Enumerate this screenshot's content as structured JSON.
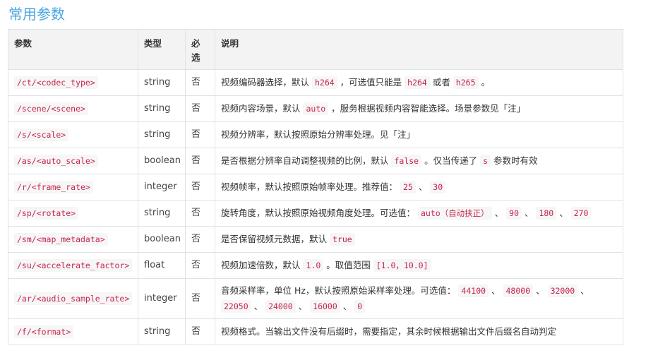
{
  "title": "常用参数",
  "headers": {
    "param": "参数",
    "type": "类型",
    "required": "必选",
    "desc": "说明"
  },
  "rows": [
    {
      "param": "/ct/<codec_type>",
      "type": "string",
      "required": "否",
      "desc": [
        {
          "t": "视频编码器选择，默认 "
        },
        {
          "c": "h264"
        },
        {
          "t": " ，可选值只能是 "
        },
        {
          "c": "h264"
        },
        {
          "t": " 或者 "
        },
        {
          "c": "h265"
        },
        {
          "t": " 。"
        }
      ]
    },
    {
      "param": "/scene/<scene>",
      "type": "string",
      "required": "否",
      "desc": [
        {
          "t": "视频内容场景，默认 "
        },
        {
          "c": "auto"
        },
        {
          "t": " ，服务根据视频内容智能选择。场景参数见「注」"
        }
      ]
    },
    {
      "param": "/s/<scale>",
      "type": "string",
      "required": "否",
      "desc": [
        {
          "t": "视频分辨率，默认按照原始分辨率处理。见「注」"
        }
      ]
    },
    {
      "param": "/as/<auto_scale>",
      "type": "boolean",
      "required": "否",
      "desc": [
        {
          "t": "是否根据分辨率自动调整视频的比例，默认 "
        },
        {
          "c": "false"
        },
        {
          "t": " 。仅当传递了 "
        },
        {
          "c": "s"
        },
        {
          "t": " 参数时有效"
        }
      ]
    },
    {
      "param": "/r/<frame_rate>",
      "type": "integer",
      "required": "否",
      "desc": [
        {
          "t": "视频帧率，默认按照原始帧率处理。推荐值： "
        },
        {
          "c": "25"
        },
        {
          "t": " 、 "
        },
        {
          "c": "30"
        }
      ]
    },
    {
      "param": "/sp/<rotate>",
      "type": "string",
      "required": "否",
      "desc": [
        {
          "t": "旋转角度，默认按照原始视频角度处理。可选值： "
        },
        {
          "c": "auto（自动扶正）"
        },
        {
          "t": " 、 "
        },
        {
          "c": "90"
        },
        {
          "t": " 、 "
        },
        {
          "c": "180"
        },
        {
          "t": " 、 "
        },
        {
          "c": "270"
        }
      ]
    },
    {
      "param": "/sm/<map_metadata>",
      "type": "boolean",
      "required": "否",
      "desc": [
        {
          "t": "是否保留视频元数据，默认 "
        },
        {
          "c": "true"
        }
      ]
    },
    {
      "param": "/su/<accelerate_factor>",
      "type": "float",
      "required": "否",
      "desc": [
        {
          "t": "视频加速倍数，默认 "
        },
        {
          "c": "1.0"
        },
        {
          "t": " 。取值范围 "
        },
        {
          "c": "[1.0，10.0]"
        }
      ]
    },
    {
      "param": "/ar/<audio_sample_rate>",
      "type": "integer",
      "required": "否",
      "tall": true,
      "desc": [
        {
          "t": "音频采样率，单位 Hz，默认按照原始采样率处理。可选值： "
        },
        {
          "c": "44100"
        },
        {
          "t": " 、 "
        },
        {
          "c": "48000"
        },
        {
          "t": " 、 "
        },
        {
          "c": "32000"
        },
        {
          "t": " 、 "
        },
        {
          "c": "22050"
        },
        {
          "t": " 、 "
        },
        {
          "c": "24000"
        },
        {
          "t": " 、 "
        },
        {
          "c": "16000"
        },
        {
          "t": " 、 "
        },
        {
          "c": "0"
        }
      ]
    },
    {
      "param": "/f/<format>",
      "type": "string",
      "required": "否",
      "desc": [
        {
          "t": "视频格式。当输出文件没有后缀时，需要指定，其余时候根据输出文件后缀名自动判定"
        }
      ]
    }
  ]
}
